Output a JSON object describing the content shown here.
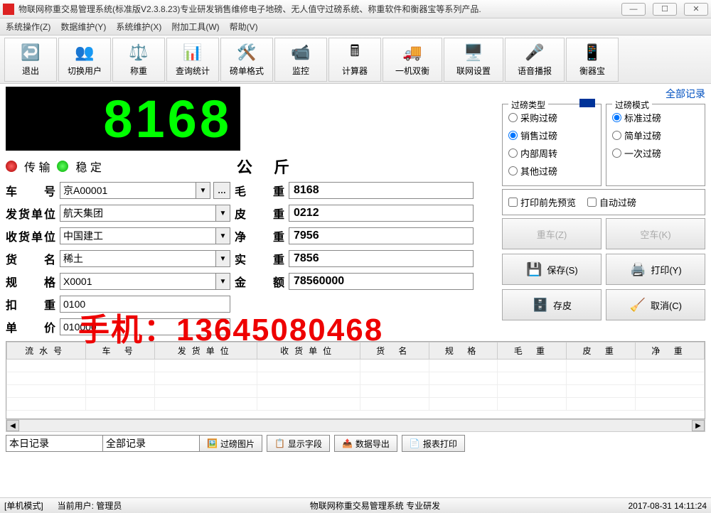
{
  "title": "物联网称重交易管理系统(标准版V2.3.8.23)专业研发销售维修电子地磅、无人值守过磅系统、称重软件和衡器宝等系列产品.",
  "menu": {
    "sys": "系统操作(Z)",
    "data": "数据维护(Y)",
    "maint": "系统维护(X)",
    "tools": "附加工具(W)",
    "help": "帮助(V)"
  },
  "toolbar": {
    "exit": "退出",
    "switch": "切换用户",
    "weigh": "称重",
    "query": "查询统计",
    "format": "磅单格式",
    "monitor": "监控",
    "calc": "计算器",
    "dual": "一机双衡",
    "net": "联网设置",
    "voice": "语音播报",
    "hqb": "衡器宝"
  },
  "display": {
    "value": "8168",
    "transmit": "传 输",
    "stable": "稳 定",
    "unit": "公 斤"
  },
  "form": {
    "carno": {
      "label": "车 号",
      "value": "京A00001"
    },
    "sender": {
      "label": "发货单位",
      "value": "航天集团"
    },
    "receiver": {
      "label": "收货单位",
      "value": "中国建工"
    },
    "goods": {
      "label": "货 名",
      "value": "稀土"
    },
    "spec": {
      "label": "规 格",
      "value": "X0001"
    },
    "deduct": {
      "label": "扣 重",
      "value": "0100"
    },
    "price": {
      "label": "单 价",
      "value": "010000"
    },
    "gross": {
      "label": "毛 重",
      "value": "8168"
    },
    "tare": {
      "label": "皮 重",
      "value": "0212"
    },
    "net": {
      "label": "净 重",
      "value": "7956"
    },
    "actual": {
      "label": "实 重",
      "value": "7856"
    },
    "amount": {
      "label": "金 额",
      "value": "78560000"
    }
  },
  "right": {
    "allrec": "全部记录",
    "typeTitle": "过磅类型",
    "modeTitle": "过磅模式",
    "types": [
      "采购过磅",
      "销售过磅",
      "内部周转",
      "其他过磅"
    ],
    "modes": [
      "标准过磅",
      "简单过磅",
      "一次过磅"
    ],
    "typeSel": "销售过磅",
    "modeSel": "标准过磅",
    "preview": "打印前先预览",
    "auto": "自动过磅",
    "btn": {
      "heavy": "重车(Z)",
      "empty": "空车(K)",
      "save": "保存(S)",
      "print": "打印(Y)",
      "storetare": "存皮",
      "cancel": "取消(C)"
    }
  },
  "watermark": "手机：13645080468",
  "columns": [
    "流水号",
    "车 号",
    "发货单位",
    "收货单位",
    "货 名",
    "规 格",
    "毛 重",
    "皮 重",
    "净 重"
  ],
  "bottom": {
    "today": "本日记录",
    "all": "全部记录",
    "img": "过磅图片",
    "field": "显示字段",
    "export": "数据导出",
    "report": "报表打印"
  },
  "status": {
    "mode": "[单机模式]",
    "user": "当前用户: 管理员",
    "sys": "物联网称重交易管理系统 专业研发",
    "time": "2017-08-31 14:11:24"
  }
}
